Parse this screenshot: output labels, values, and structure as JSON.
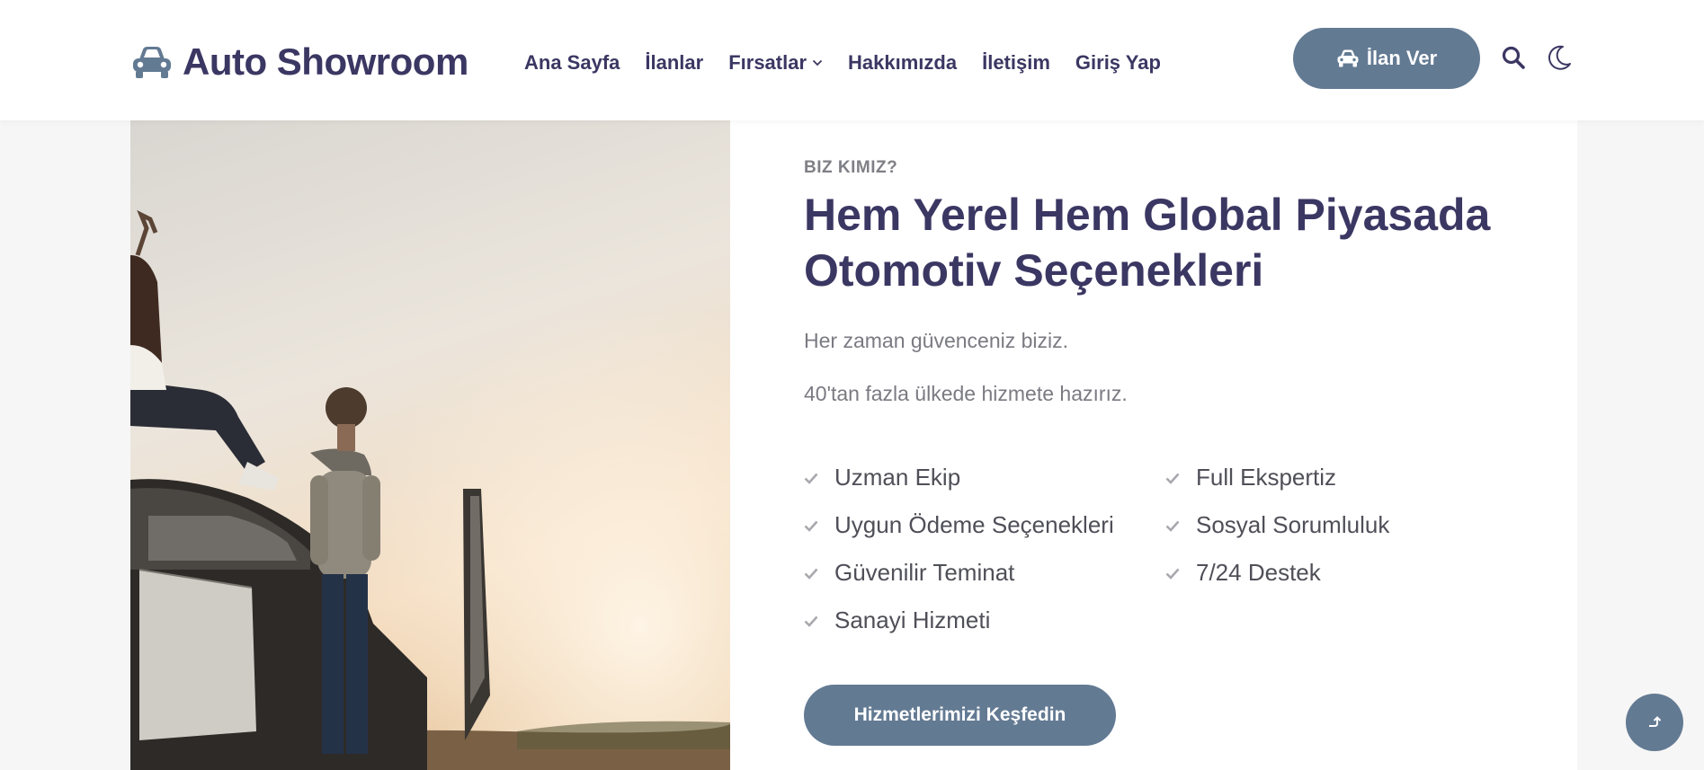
{
  "header": {
    "logo_text": "Auto Showroom",
    "nav": [
      {
        "label": "Ana Sayfa"
      },
      {
        "label": "İlanlar"
      },
      {
        "label": "Fırsatlar",
        "has_dropdown": true
      },
      {
        "label": "Hakkımızda"
      },
      {
        "label": "İletişim"
      },
      {
        "label": "Giriş Yap"
      }
    ],
    "post_button_label": "İlan Ver",
    "icons": [
      "car-icon",
      "chevron-down-icon",
      "search-icon",
      "moon-icon"
    ]
  },
  "about": {
    "eyebrow": "BIZ KIMIZ?",
    "heading": "Hem Yerel Hem Global Piyasada Otomotiv Seçenekleri",
    "paragraphs": [
      "Her zaman güvenceniz biziz.",
      "40'tan fazla ülkede hizmete hazırız."
    ],
    "features": [
      "Uzman Ekip",
      "Full Ekspertiz",
      "Uygun Ödeme Seçenekleri",
      "Sosyal Sorumluluk",
      "Güvenilir Teminat",
      "7/24 Destek",
      "Sanayi Hizmeti"
    ],
    "cta_label": "Hizmetlerimizi Keşfedin"
  },
  "colors": {
    "accent": "#637a93",
    "heading": "#3b3763",
    "muted_text": "#7a7a82",
    "background": "#f6f6f6"
  }
}
